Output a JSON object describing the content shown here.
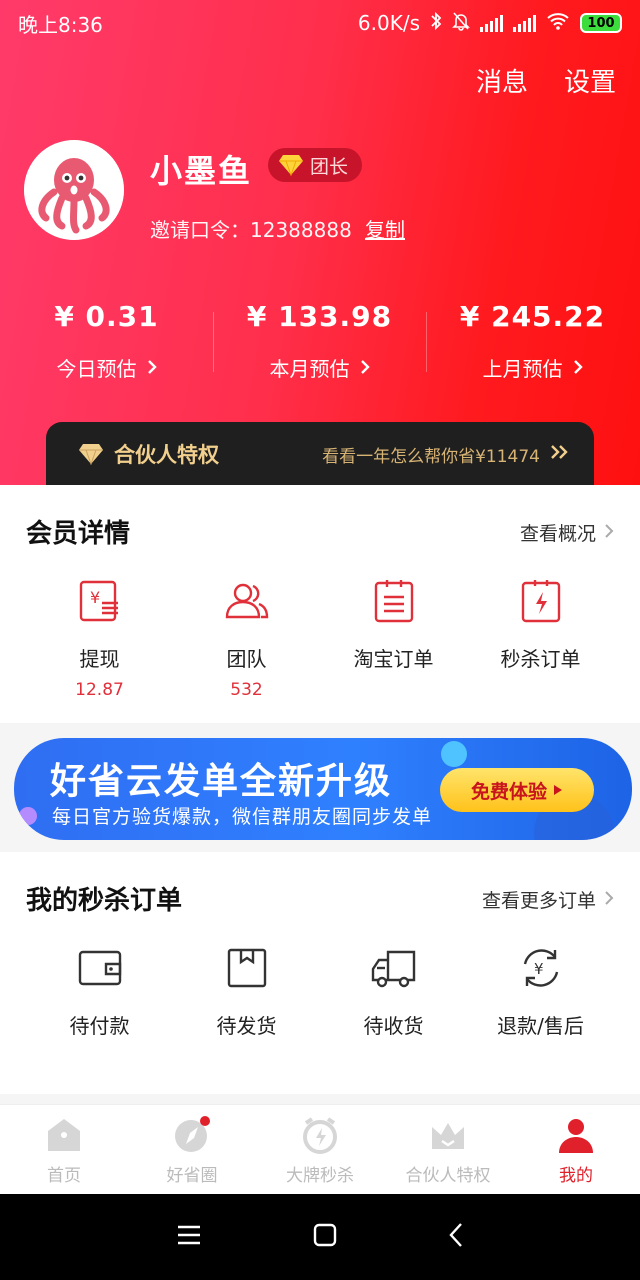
{
  "status": {
    "time": "晚上8:36",
    "speed": "6.0K/s",
    "battery": "100"
  },
  "topnav": {
    "messages": "消息",
    "settings": "设置"
  },
  "profile": {
    "nickname": "小墨鱼",
    "badge": "团长",
    "invite_label": "邀请口令：12388888",
    "copy": "复制"
  },
  "earnings": [
    {
      "value": "¥ 0.31",
      "label": "今日预估"
    },
    {
      "value": "¥ 133.98",
      "label": "本月预估"
    },
    {
      "value": "¥ 245.22",
      "label": "上月预估"
    }
  ],
  "partner": {
    "title": "合伙人特权",
    "promo": "看看一年怎么帮你省¥11474"
  },
  "member": {
    "title": "会员详情",
    "more": "查看概况",
    "items": [
      {
        "label": "提现",
        "value": "12.87",
        "icon": "withdraw-icon"
      },
      {
        "label": "团队",
        "value": "532",
        "icon": "team-icon"
      },
      {
        "label": "淘宝订单",
        "value": "",
        "icon": "taobao-order-icon"
      },
      {
        "label": "秒杀订单",
        "value": "",
        "icon": "flash-order-icon"
      }
    ]
  },
  "banner": {
    "title": "好省云发单全新升级",
    "subtitle": "每日官方验货爆款，微信群朋友圈同步发单",
    "button": "免费体验"
  },
  "orders": {
    "title": "我的秒杀订单",
    "more": "查看更多订单",
    "items": [
      {
        "label": "待付款",
        "icon": "wallet-icon"
      },
      {
        "label": "待发货",
        "icon": "box-icon"
      },
      {
        "label": "待收货",
        "icon": "truck-icon"
      },
      {
        "label": "退款/售后",
        "icon": "refund-icon"
      }
    ]
  },
  "tabs": [
    {
      "label": "首页",
      "icon": "home-icon"
    },
    {
      "label": "好省圈",
      "icon": "circle-icon"
    },
    {
      "label": "大牌秒杀",
      "icon": "flash-sale-icon"
    },
    {
      "label": "合伙人特权",
      "icon": "crown-icon"
    },
    {
      "label": "我的",
      "icon": "user-icon"
    }
  ],
  "colors": {
    "accent": "#e0202a",
    "gold": "#f1cf8d",
    "banner_blue": "#2f80ff"
  }
}
